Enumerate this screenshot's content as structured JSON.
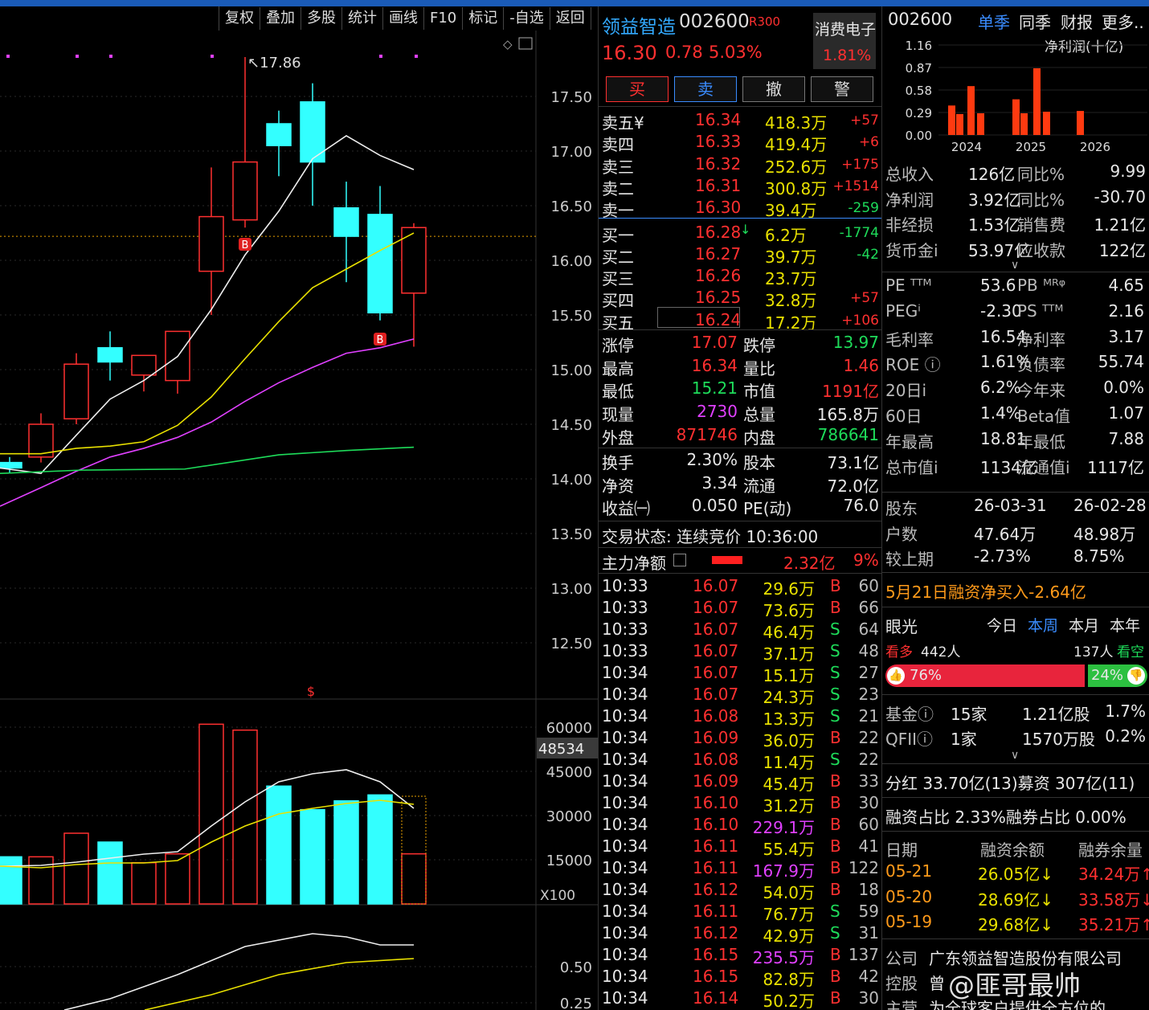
{
  "toolbar": [
    "复权",
    "叠加",
    "多股",
    "统计",
    "画线",
    "F10",
    "标记",
    "-自选",
    "返回"
  ],
  "chart": {
    "high_label": "17.86",
    "price_axis": [
      "17.50",
      "17.00",
      "16.50",
      "16.00",
      "15.50",
      "15.00",
      "14.50",
      "14.00",
      "13.50",
      "13.00",
      "12.50"
    ],
    "vol_axis": [
      "60000",
      "45000",
      "30000",
      "15000"
    ],
    "vol_current": "48534",
    "vol_unit": "X100",
    "ind_axis": [
      "0.50",
      "0.25"
    ],
    "b_mark": "B",
    "s_mark": "$"
  },
  "chart_data": {
    "type": "candlestick",
    "candles": [
      {
        "o": 14.15,
        "c": 14.1,
        "h": 14.2,
        "l": 14.05
      },
      {
        "o": 14.2,
        "c": 14.5,
        "h": 14.6,
        "l": 14.15
      },
      {
        "o": 14.55,
        "c": 15.05,
        "h": 15.15,
        "l": 14.5
      },
      {
        "o": 15.2,
        "c": 15.07,
        "h": 15.35,
        "l": 14.9
      },
      {
        "o": 14.95,
        "c": 15.13,
        "h": 15.13,
        "l": 14.8
      },
      {
        "o": 14.9,
        "c": 15.35,
        "h": 15.35,
        "l": 14.78
      },
      {
        "o": 15.9,
        "c": 16.4,
        "h": 16.85,
        "l": 15.5
      },
      {
        "o": 16.37,
        "c": 16.9,
        "h": 17.86,
        "l": 16.3
      },
      {
        "o": 17.25,
        "c": 17.05,
        "h": 17.37,
        "l": 16.77
      },
      {
        "o": 17.45,
        "c": 16.9,
        "h": 17.62,
        "l": 16.5
      },
      {
        "o": 16.48,
        "c": 16.22,
        "h": 16.72,
        "l": 15.8
      },
      {
        "o": 16.42,
        "c": 15.52,
        "h": 16.68,
        "l": 15.45
      },
      {
        "o": 15.7,
        "c": 16.3,
        "h": 16.34,
        "l": 15.21
      }
    ],
    "volumes": [
      16000,
      16000,
      24000,
      21000,
      14000,
      17000,
      61000,
      59000,
      40000,
      32000,
      35000,
      37000,
      17000
    ]
  },
  "quote": {
    "name": "领益智造",
    "code": "002600",
    "badge": "R300",
    "sector": "消费电子",
    "sector_pct": "1.81%",
    "price": "16.30",
    "change": "0.78",
    "pct": "5.03%",
    "buttons": [
      "买",
      "卖",
      "撤",
      "警"
    ]
  },
  "book": [
    [
      "卖五¥",
      "16.34",
      "418.3万",
      "+57"
    ],
    [
      "卖四",
      "16.33",
      "419.4万",
      "+6"
    ],
    [
      "卖三",
      "16.32",
      "252.6万",
      "+175"
    ],
    [
      "卖二",
      "16.31",
      "300.8万",
      "+1514"
    ],
    [
      "卖一",
      "16.30",
      "39.4万",
      "-259"
    ],
    [
      "买一",
      "16.28",
      "6.2万",
      "-1774"
    ],
    [
      "买二",
      "16.27",
      "39.7万",
      "-42"
    ],
    [
      "买三",
      "16.26",
      "23.7万",
      ""
    ],
    [
      "买四",
      "16.25",
      "32.8万",
      "+57"
    ],
    [
      "买五",
      "16.24",
      "17.2万",
      "+106"
    ]
  ],
  "stats": [
    [
      "涨停",
      "17.07",
      "跌停",
      "13.97"
    ],
    [
      "最高",
      "16.34",
      "量比",
      "1.46"
    ],
    [
      "最低",
      "15.21",
      "市值",
      "1191亿"
    ],
    [
      "现量",
      "2730",
      "总量",
      "165.8万"
    ],
    [
      "外盘",
      "871746",
      "内盘",
      "786641"
    ]
  ],
  "stats2": [
    [
      "换手",
      "2.30%",
      "股本",
      "73.1亿"
    ],
    [
      "净资",
      "3.34",
      "流通",
      "72.0亿"
    ],
    [
      "收益㈠",
      "0.050",
      "PE(动)",
      "76.0"
    ]
  ],
  "trade_state": "交易状态: 连续竞价 10:36:00",
  "main_net": {
    "label": "主力净额",
    "value": "2.32亿",
    "pct": "9%"
  },
  "ticks": [
    [
      "10:33",
      "16.07",
      "29.6万",
      "B",
      "60"
    ],
    [
      "10:33",
      "16.07",
      "73.6万",
      "B",
      "66"
    ],
    [
      "10:33",
      "16.07",
      "46.4万",
      "S",
      "64"
    ],
    [
      "10:33",
      "16.07",
      "37.1万",
      "S",
      "48"
    ],
    [
      "10:34",
      "16.07",
      "15.1万",
      "S",
      "27"
    ],
    [
      "10:34",
      "16.07",
      "24.3万",
      "S",
      "23"
    ],
    [
      "10:34",
      "16.08",
      "13.3万",
      "S",
      "21"
    ],
    [
      "10:34",
      "16.09",
      "36.0万",
      "B",
      "22"
    ],
    [
      "10:34",
      "16.08",
      "11.4万",
      "S",
      "22"
    ],
    [
      "10:34",
      "16.09",
      "45.4万",
      "B",
      "33"
    ],
    [
      "10:34",
      "16.10",
      "31.2万",
      "B",
      "30"
    ],
    [
      "10:34",
      "16.10",
      "229.1万",
      "B",
      "60"
    ],
    [
      "10:34",
      "16.11",
      "55.4万",
      "B",
      "41"
    ],
    [
      "10:34",
      "16.11",
      "167.9万",
      "B",
      "122"
    ],
    [
      "10:34",
      "16.12",
      "54.0万",
      "B",
      "18"
    ],
    [
      "10:34",
      "16.11",
      "76.7万",
      "S",
      "59"
    ],
    [
      "10:34",
      "16.12",
      "42.9万",
      "S",
      "31"
    ],
    [
      "10:34",
      "16.15",
      "235.5万",
      "B",
      "137"
    ],
    [
      "10:34",
      "16.15",
      "82.8万",
      "B",
      "42"
    ],
    [
      "10:34",
      "16.14",
      "50.2万",
      "B",
      "30"
    ]
  ],
  "right": {
    "code": "002600",
    "tabs": [
      "单季",
      "同季",
      "财报",
      "更多.."
    ],
    "fin_title": "净利润(十亿)",
    "fin_axis": [
      "1.16",
      "0.87",
      "0.58",
      "0.29",
      "0.00"
    ],
    "fin_years": [
      "2024",
      "2025",
      "2026"
    ],
    "fin_rows": [
      [
        "总收入",
        "126亿",
        "同比%",
        "9.99"
      ],
      [
        "净利润",
        "3.92亿",
        "同比%",
        "-30.70"
      ],
      [
        "非经损",
        "1.53亿",
        "销售费",
        "1.21亿"
      ],
      [
        "货币金i",
        "53.97亿",
        "应收款",
        "122亿"
      ]
    ],
    "val_rows": [
      [
        "PE ᵀᵀᴹ",
        "53.6",
        "PB ᴹᴿᵠ",
        "4.65"
      ],
      [
        "PEGⁱ",
        "-2.30",
        "PS ᵀᵀᴹ",
        "2.16"
      ],
      [
        "毛利率",
        "16.54",
        "净利率",
        "3.17"
      ],
      [
        "ROE ⓘ",
        "1.61%",
        "负债率",
        "55.74"
      ],
      [
        "20日i",
        "6.2%",
        "今年来",
        "0.0%"
      ],
      [
        "60日",
        "1.4%",
        "Beta值",
        "1.07"
      ],
      [
        "年最高",
        "18.81",
        "年最低",
        "7.88"
      ],
      [
        "总市值i",
        "1134亿",
        "流通值i",
        "1117亿"
      ]
    ],
    "holders": [
      [
        "股东",
        "26-03-31",
        "26-02-28"
      ],
      [
        "户数",
        "47.64万",
        "48.98万"
      ],
      [
        "较上期",
        "-2.73%",
        "8.75%"
      ]
    ],
    "margin_news": "5月21日融资净买入-2.64亿",
    "vision": {
      "label": "眼光",
      "tabs": [
        "今日",
        "本周",
        "本月",
        "本年"
      ],
      "bull": "看多",
      "bull_n": "442人",
      "bear_n": "137人",
      "bear": "看空",
      "bull_pct": "76%",
      "bear_pct": "24%"
    },
    "inst": [
      [
        "基金ⓘ",
        "15家",
        "1.21亿股",
        "1.7%"
      ],
      [
        "QFIIⓘ",
        "1家",
        "1570万股",
        "0.2%"
      ]
    ],
    "div": "分红  33.70亿(13)募资  307亿(11)",
    "ratio": "融资占比  2.33%融券占比  0.00%",
    "margin_head": [
      "日期",
      "融资余额",
      "融券余量"
    ],
    "margin_rows": [
      [
        "05-21",
        "26.05亿↓",
        "34.24万↑"
      ],
      [
        "05-20",
        "28.69亿↓",
        "33.58万↓"
      ],
      [
        "05-19",
        "29.68亿↓",
        "35.21万↑"
      ]
    ],
    "company": [
      [
        "公司",
        "广东领益智造股份有限公司"
      ],
      [
        "控股",
        "曾"
      ],
      [
        "主营",
        "为全球客户提供全方位的"
      ]
    ],
    "watermark": "@匪哥最帅"
  }
}
